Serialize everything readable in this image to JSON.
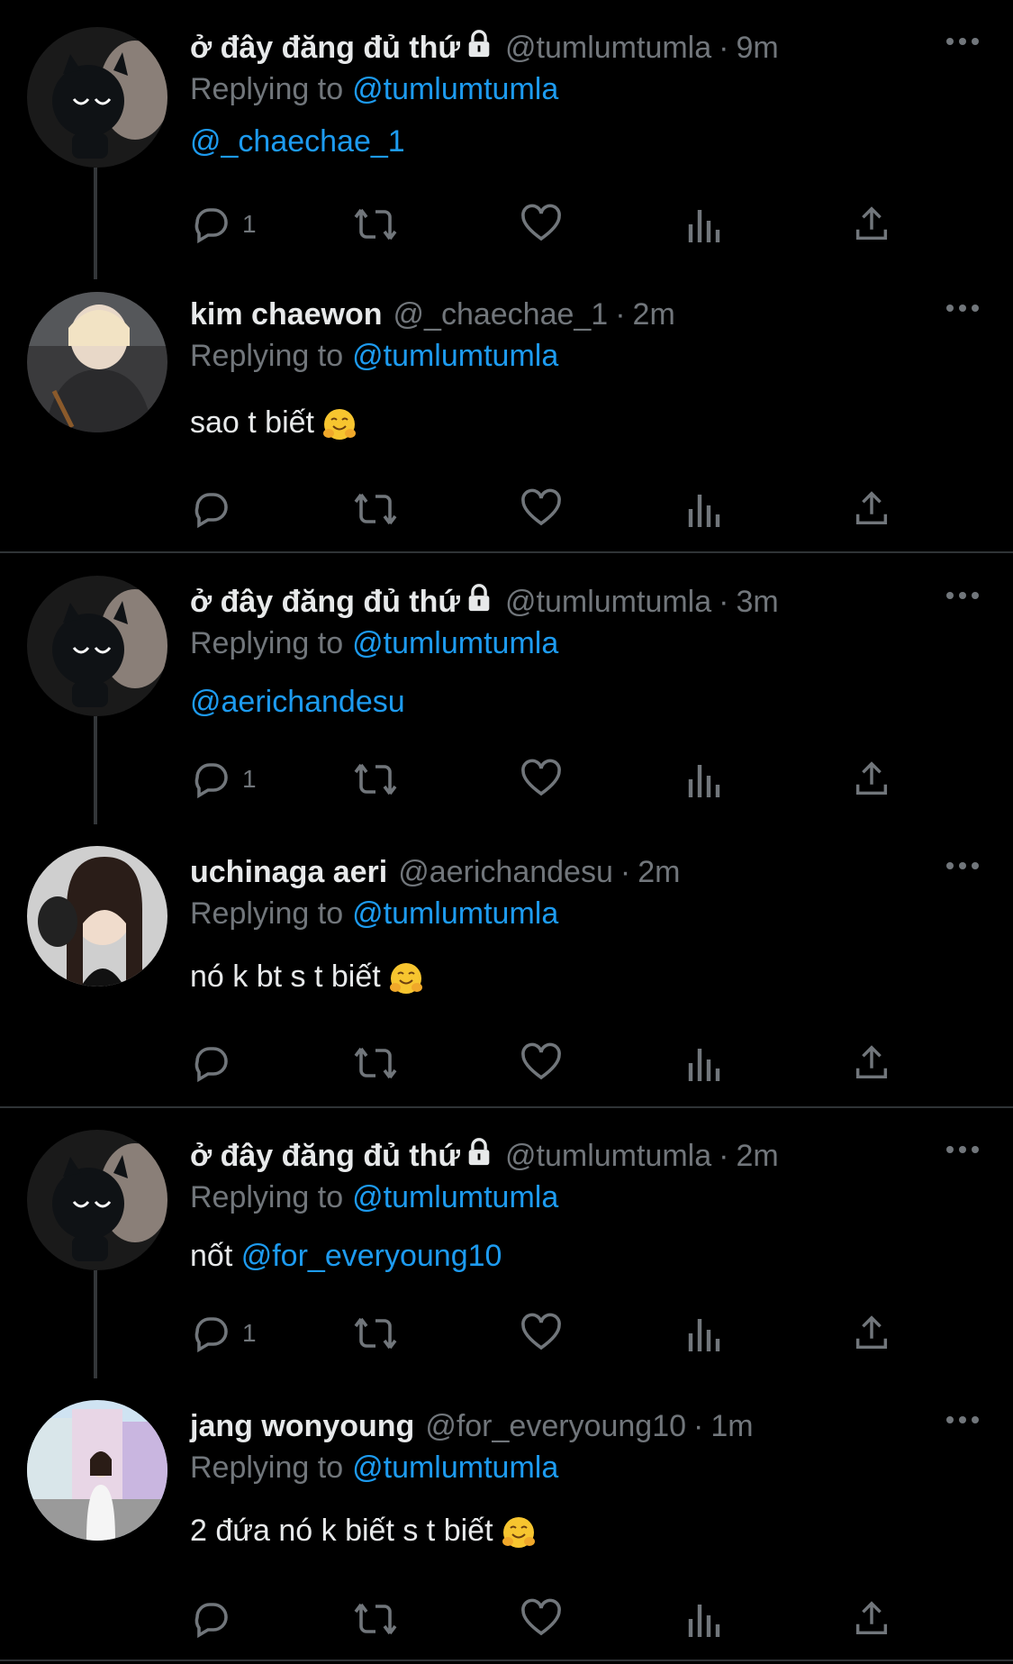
{
  "tweets": [
    {
      "name": "ở đây đăng đủ thứ",
      "locked": true,
      "handle": "@tumlumtumla",
      "time": "9m",
      "replying_label": "Replying to",
      "replying_to": "@tumlumtumla",
      "text": "",
      "mention": "@_chaechae_1",
      "reply_count": "1",
      "avatar": "black-cat-plush"
    },
    {
      "name": "kim chaewon",
      "locked": false,
      "handle": "@_chaechae_1",
      "time": "2m",
      "replying_label": "Replying to",
      "replying_to": "@tumlumtumla",
      "text": "sao t biết",
      "mention": "",
      "reply_count": "",
      "avatar": "photo-chaewon"
    },
    {
      "name": "ở đây đăng đủ thứ",
      "locked": true,
      "handle": "@tumlumtumla",
      "time": "3m",
      "replying_label": "Replying to",
      "replying_to": "@tumlumtumla",
      "text": "",
      "mention": "@aerichandesu",
      "reply_count": "1",
      "avatar": "black-cat-plush"
    },
    {
      "name": "uchinaga aeri",
      "locked": false,
      "handle": "@aerichandesu",
      "time": "2m",
      "replying_label": "Replying to",
      "replying_to": "@tumlumtumla",
      "text": "nó k bt s t biết",
      "mention": "",
      "reply_count": "",
      "avatar": "photo-aeri"
    },
    {
      "name": "ở đây đăng đủ thứ",
      "locked": true,
      "handle": "@tumlumtumla",
      "time": "2m",
      "replying_label": "Replying to",
      "replying_to": "@tumlumtumla",
      "text": "nốt",
      "mention": "@for_everyoung10",
      "reply_count": "1",
      "avatar": "black-cat-plush"
    },
    {
      "name": "jang wonyoung",
      "locked": false,
      "handle": "@for_everyoung10",
      "time": "1m",
      "replying_label": "Replying to",
      "replying_to": "@tumlumtumla",
      "text": "2 đứa nó k biết s t biết",
      "mention": "",
      "reply_count": "",
      "avatar": "photo-wonyoung"
    }
  ],
  "dot_separator": "·",
  "colors": {
    "background": "#000000",
    "accent": "#1d9bf0",
    "muted": "#71767b",
    "text": "#e7e9ea"
  }
}
